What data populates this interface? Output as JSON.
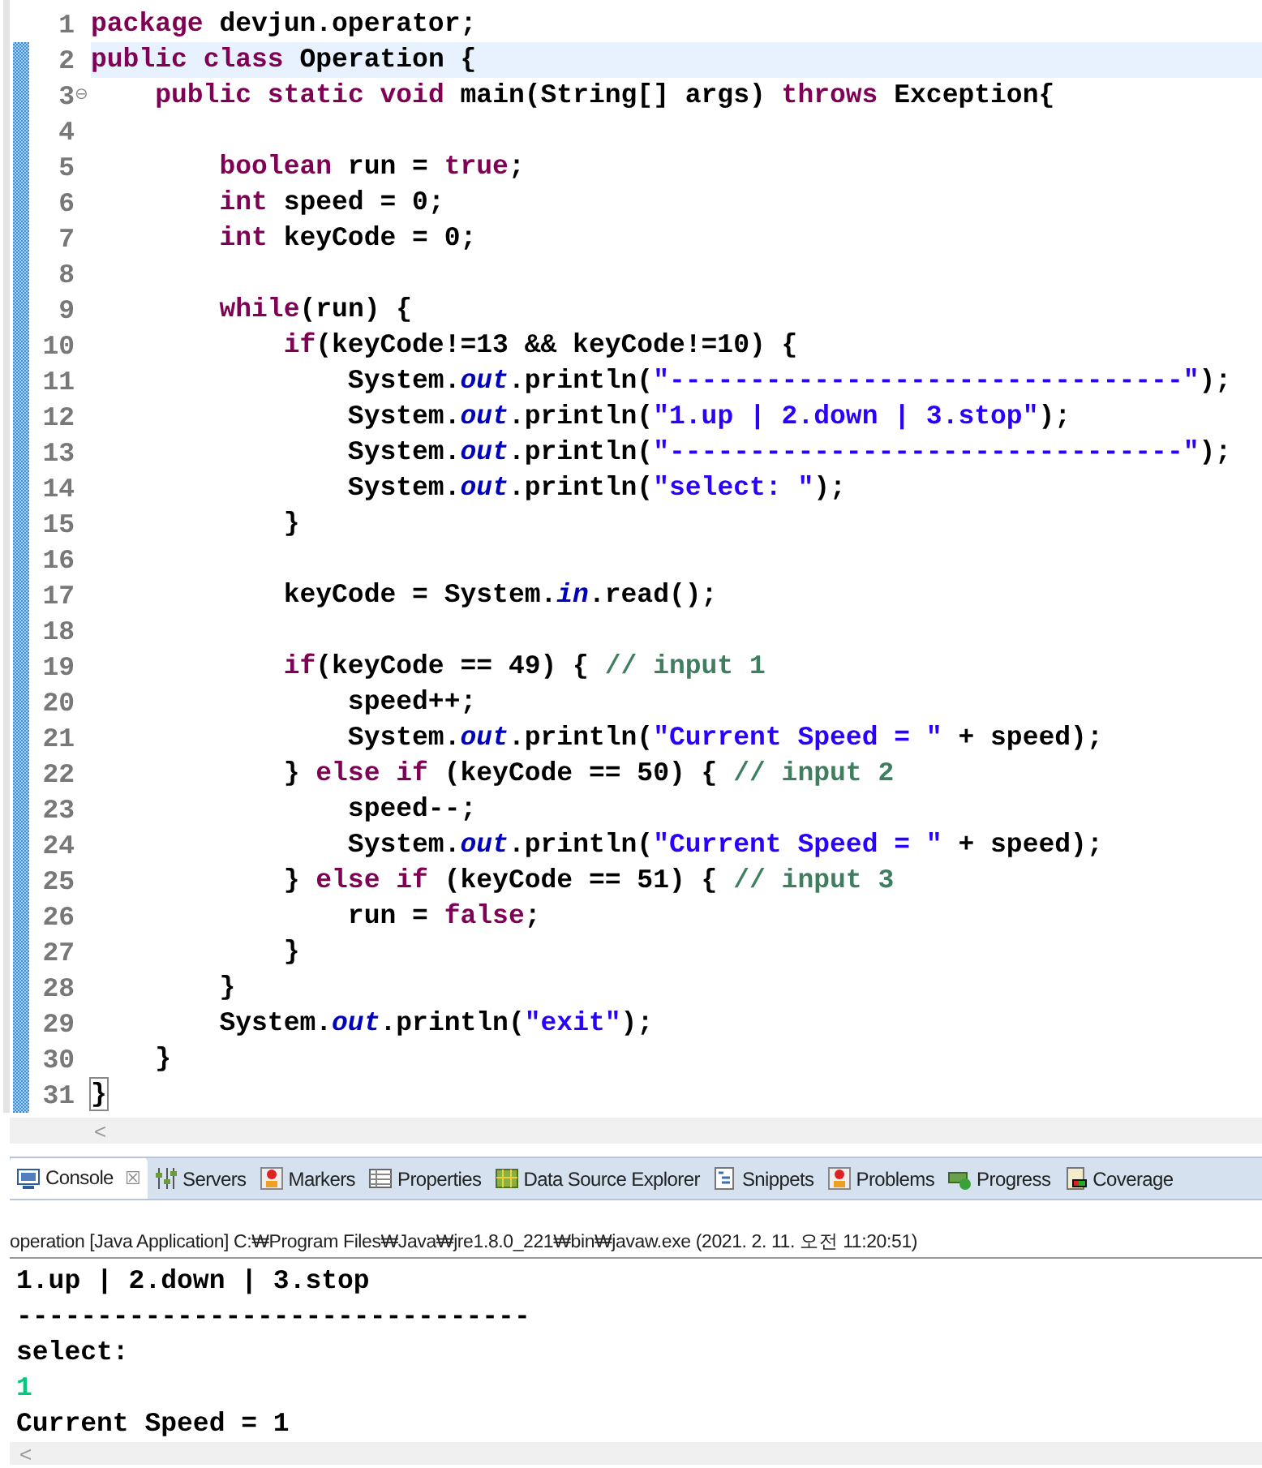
{
  "editor": {
    "lines": [
      {
        "number": "1",
        "changed": false,
        "current": false,
        "tokens": [
          {
            "kind": "keyword",
            "text": "package"
          },
          {
            "kind": "plain",
            "text": " devjun.operator;"
          }
        ]
      },
      {
        "number": "2",
        "changed": true,
        "current": true,
        "tokens": [
          {
            "kind": "keyword",
            "text": "public"
          },
          {
            "kind": "keyword",
            "text": " class"
          },
          {
            "kind": "plain",
            "text": " Operation {"
          }
        ]
      },
      {
        "number": "3",
        "changed": true,
        "current": false,
        "fold": "⊖",
        "tokens": [
          {
            "kind": "keyword",
            "text": "    public"
          },
          {
            "kind": "keyword",
            "text": " static"
          },
          {
            "kind": "keyword",
            "text": " void"
          },
          {
            "kind": "plain",
            "text": " main(String[] args) "
          },
          {
            "kind": "keyword",
            "text": "throws"
          },
          {
            "kind": "plain",
            "text": " Exception{"
          }
        ]
      },
      {
        "number": "4",
        "changed": true,
        "current": false
      },
      {
        "number": "5",
        "changed": true,
        "current": false,
        "tokens": [
          {
            "kind": "keyword",
            "text": "        boolean"
          },
          {
            "kind": "plain",
            "text": " run = "
          },
          {
            "kind": "keyword",
            "text": "true"
          },
          {
            "kind": "plain",
            "text": ";"
          }
        ]
      },
      {
        "number": "6",
        "changed": true,
        "current": false,
        "tokens": [
          {
            "kind": "keyword",
            "text": "        int"
          },
          {
            "kind": "plain",
            "text": " speed = 0;"
          }
        ]
      },
      {
        "number": "7",
        "changed": true,
        "current": false,
        "tokens": [
          {
            "kind": "keyword",
            "text": "        int"
          },
          {
            "kind": "plain",
            "text": " keyCode = 0;"
          }
        ]
      },
      {
        "number": "8",
        "changed": true,
        "current": false
      },
      {
        "number": "9",
        "changed": true,
        "current": false,
        "tokens": [
          {
            "kind": "keyword",
            "text": "        while"
          },
          {
            "kind": "plain",
            "text": "(run) {"
          }
        ]
      },
      {
        "number": "10",
        "changed": true,
        "current": false,
        "tokens": [
          {
            "kind": "keyword",
            "text": "            if"
          },
          {
            "kind": "plain",
            "text": "(keyCode!=13 && keyCode!=10) {"
          }
        ]
      },
      {
        "number": "11",
        "changed": true,
        "current": false,
        "tokens": [
          {
            "kind": "plain",
            "text": "                System."
          },
          {
            "kind": "field",
            "text": "out"
          },
          {
            "kind": "plain",
            "text": ".println("
          },
          {
            "kind": "string",
            "text": "\"--------------------------------\""
          },
          {
            "kind": "plain",
            "text": ");"
          }
        ]
      },
      {
        "number": "12",
        "changed": true,
        "current": false,
        "tokens": [
          {
            "kind": "plain",
            "text": "                System."
          },
          {
            "kind": "field",
            "text": "out"
          },
          {
            "kind": "plain",
            "text": ".println("
          },
          {
            "kind": "string",
            "text": "\"1.up | 2.down | 3.stop\""
          },
          {
            "kind": "plain",
            "text": ");"
          }
        ]
      },
      {
        "number": "13",
        "changed": true,
        "current": false,
        "tokens": [
          {
            "kind": "plain",
            "text": "                System."
          },
          {
            "kind": "field",
            "text": "out"
          },
          {
            "kind": "plain",
            "text": ".println("
          },
          {
            "kind": "string",
            "text": "\"--------------------------------\""
          },
          {
            "kind": "plain",
            "text": ");"
          }
        ]
      },
      {
        "number": "14",
        "changed": true,
        "current": false,
        "tokens": [
          {
            "kind": "plain",
            "text": "                System."
          },
          {
            "kind": "field",
            "text": "out"
          },
          {
            "kind": "plain",
            "text": ".println("
          },
          {
            "kind": "string",
            "text": "\"select: \""
          },
          {
            "kind": "plain",
            "text": ");"
          }
        ]
      },
      {
        "number": "15",
        "changed": true,
        "current": false,
        "tokens": [
          {
            "kind": "plain",
            "text": "            }"
          }
        ]
      },
      {
        "number": "16",
        "changed": true,
        "current": false
      },
      {
        "number": "17",
        "changed": true,
        "current": false,
        "tokens": [
          {
            "kind": "plain",
            "text": "            keyCode = System."
          },
          {
            "kind": "field",
            "text": "in"
          },
          {
            "kind": "plain",
            "text": ".read();"
          }
        ]
      },
      {
        "number": "18",
        "changed": true,
        "current": false
      },
      {
        "number": "19",
        "changed": true,
        "current": false,
        "tokens": [
          {
            "kind": "keyword",
            "text": "            if"
          },
          {
            "kind": "plain",
            "text": "(keyCode == 49) { "
          },
          {
            "kind": "comment",
            "text": "// input 1"
          }
        ]
      },
      {
        "number": "20",
        "changed": true,
        "current": false,
        "tokens": [
          {
            "kind": "plain",
            "text": "                speed++;"
          }
        ]
      },
      {
        "number": "21",
        "changed": true,
        "current": false,
        "tokens": [
          {
            "kind": "plain",
            "text": "                System."
          },
          {
            "kind": "field",
            "text": "out"
          },
          {
            "kind": "plain",
            "text": ".println("
          },
          {
            "kind": "string",
            "text": "\"Current Speed = \""
          },
          {
            "kind": "plain",
            "text": " + speed);"
          }
        ]
      },
      {
        "number": "22",
        "changed": true,
        "current": false,
        "tokens": [
          {
            "kind": "plain",
            "text": "            } "
          },
          {
            "kind": "keyword",
            "text": "else"
          },
          {
            "kind": "keyword",
            "text": " if"
          },
          {
            "kind": "plain",
            "text": " (keyCode == 50) { "
          },
          {
            "kind": "comment",
            "text": "// input 2"
          }
        ]
      },
      {
        "number": "23",
        "changed": true,
        "current": false,
        "tokens": [
          {
            "kind": "plain",
            "text": "                speed--;"
          }
        ]
      },
      {
        "number": "24",
        "changed": true,
        "current": false,
        "tokens": [
          {
            "kind": "plain",
            "text": "                System."
          },
          {
            "kind": "field",
            "text": "out"
          },
          {
            "kind": "plain",
            "text": ".println("
          },
          {
            "kind": "string",
            "text": "\"Current Speed = \""
          },
          {
            "kind": "plain",
            "text": " + speed);"
          }
        ]
      },
      {
        "number": "25",
        "changed": true,
        "current": false,
        "tokens": [
          {
            "kind": "plain",
            "text": "            } "
          },
          {
            "kind": "keyword",
            "text": "else"
          },
          {
            "kind": "keyword",
            "text": " if"
          },
          {
            "kind": "plain",
            "text": " (keyCode == 51) { "
          },
          {
            "kind": "comment",
            "text": "// input 3"
          }
        ]
      },
      {
        "number": "26",
        "changed": true,
        "current": false,
        "tokens": [
          {
            "kind": "plain",
            "text": "                run = "
          },
          {
            "kind": "keyword",
            "text": "false"
          },
          {
            "kind": "plain",
            "text": ";"
          }
        ]
      },
      {
        "number": "27",
        "changed": true,
        "current": false,
        "tokens": [
          {
            "kind": "plain",
            "text": "            }"
          }
        ]
      },
      {
        "number": "28",
        "changed": true,
        "current": false,
        "tokens": [
          {
            "kind": "plain",
            "text": "        }"
          }
        ]
      },
      {
        "number": "29",
        "changed": true,
        "current": false,
        "tokens": [
          {
            "kind": "plain",
            "text": "        System."
          },
          {
            "kind": "field",
            "text": "out"
          },
          {
            "kind": "plain",
            "text": ".println("
          },
          {
            "kind": "string",
            "text": "\"exit\""
          },
          {
            "kind": "plain",
            "text": ");"
          }
        ]
      },
      {
        "number": "30",
        "changed": true,
        "current": false,
        "tokens": [
          {
            "kind": "plain",
            "text": "    }"
          }
        ]
      },
      {
        "number": "31",
        "changed": true,
        "current": false,
        "tokens": [
          {
            "kind": "bracket",
            "text": "}"
          }
        ]
      }
    ],
    "scroll_arrow": "<"
  },
  "views": {
    "tabs": [
      {
        "label": "Console",
        "selected": true,
        "close": "☒"
      },
      {
        "label": "Servers",
        "selected": false
      },
      {
        "label": "Markers",
        "selected": false
      },
      {
        "label": "Properties",
        "selected": false
      },
      {
        "label": "Data Source Explorer",
        "selected": false
      },
      {
        "label": "Snippets",
        "selected": false
      },
      {
        "label": "Problems",
        "selected": false
      },
      {
        "label": "Progress",
        "selected": false
      },
      {
        "label": "Coverage",
        "selected": false
      }
    ]
  },
  "console": {
    "header": "operation [Java Application] C:₩Program Files₩Java₩jre1.8.0_221₩bin₩javaw.exe (2021. 2. 11. 오전 11:20:51)",
    "output": [
      {
        "kind": "output",
        "text": "1.up | 2.down | 3.stop"
      },
      {
        "kind": "output",
        "text": "--------------------------------"
      },
      {
        "kind": "output",
        "text": "select: "
      },
      {
        "kind": "input",
        "text": "1"
      },
      {
        "kind": "output",
        "text": "Current Speed = 1"
      }
    ],
    "scroll_arrow": "<"
  }
}
